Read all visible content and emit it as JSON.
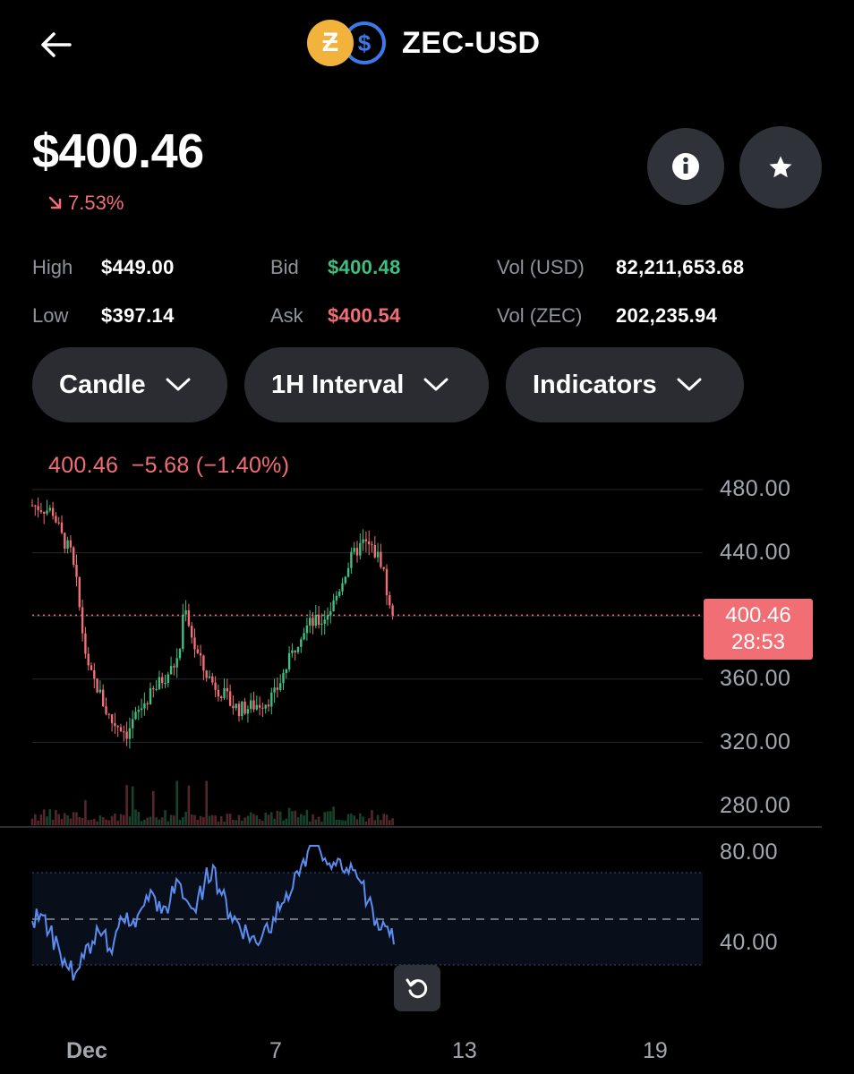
{
  "header": {
    "back_icon": "arrow-left-icon",
    "pair": "ZEC-USD",
    "base_symbol": "Ƶ",
    "quote_symbol": "$"
  },
  "price": {
    "current": "$400.46",
    "change_pct": "7.53%",
    "change_direction": "down"
  },
  "actions": {
    "info_icon": "info-icon",
    "favorite_icon": "star-icon"
  },
  "stats": {
    "high_label": "High",
    "high_value": "$449.00",
    "low_label": "Low",
    "low_value": "$397.14",
    "bid_label": "Bid",
    "bid_value": "$400.48",
    "ask_label": "Ask",
    "ask_value": "$400.54",
    "vol_usd_label": "Vol (USD)",
    "vol_usd_value": "82,211,653.68",
    "vol_zec_label": "Vol (ZEC)",
    "vol_zec_value": "202,235.94"
  },
  "controls": {
    "chart_type": "Candle",
    "interval": "1H Interval",
    "indicators": "Indicators"
  },
  "chart_data": [
    {
      "type": "candlestick",
      "ohlc_header": {
        "last": "400.46",
        "change": "−5.68",
        "change_pct": "(−1.40%)"
      },
      "current_price_tag": {
        "price": "400.46",
        "countdown": "28:53"
      },
      "y_ticks": [
        "480.00",
        "440.00",
        "360.00",
        "320.00",
        "280.00"
      ],
      "ylim": [
        280,
        480
      ],
      "x_ticks": [
        "Dec",
        "7",
        "13",
        "19"
      ],
      "close_path": [
        [
          0,
          470
        ],
        [
          4,
          468
        ],
        [
          7,
          466
        ],
        [
          10,
          450
        ],
        [
          13,
          440
        ],
        [
          15,
          420
        ],
        [
          17,
          390
        ],
        [
          19,
          365
        ],
        [
          22,
          355
        ],
        [
          25,
          340
        ],
        [
          27,
          333
        ],
        [
          30,
          330
        ],
        [
          32,
          326
        ],
        [
          35,
          336
        ],
        [
          38,
          345
        ],
        [
          41,
          352
        ],
        [
          44,
          360
        ],
        [
          47,
          366
        ],
        [
          49,
          372
        ],
        [
          50,
          380
        ],
        [
          51,
          400
        ],
        [
          52,
          407
        ],
        [
          53,
          396
        ],
        [
          55,
          380
        ],
        [
          58,
          366
        ],
        [
          61,
          358
        ],
        [
          64,
          352
        ],
        [
          67,
          345
        ],
        [
          70,
          341
        ],
        [
          73,
          342
        ],
        [
          76,
          344
        ],
        [
          79,
          346
        ],
        [
          82,
          350
        ],
        [
          85,
          363
        ],
        [
          88,
          376
        ],
        [
          91,
          390
        ],
        [
          94,
          395
        ],
        [
          96,
          396
        ],
        [
          98,
          397
        ],
        [
          100,
          402
        ],
        [
          102,
          408
        ],
        [
          104,
          418
        ],
        [
          106,
          428
        ],
        [
          108,
          436
        ],
        [
          110,
          442
        ],
        [
          112,
          446
        ],
        [
          114,
          444
        ],
        [
          116,
          440
        ],
        [
          118,
          435
        ],
        [
          119,
          428
        ],
        [
          120,
          415
        ],
        [
          121,
          404
        ],
        [
          122,
          400.46
        ]
      ],
      "volume_note": "volume bars along bottom of price pane"
    },
    {
      "type": "line",
      "name": "",
      "y_ticks": [
        "80.00",
        "40.00"
      ],
      "ylim": [
        30,
        90
      ],
      "midline": 50,
      "values": [
        48,
        52,
        44,
        38,
        30,
        26,
        34,
        41,
        44,
        38,
        46,
        52,
        47,
        55,
        61,
        52,
        58,
        66,
        57,
        54,
        66,
        72,
        60,
        52,
        48,
        44,
        40,
        46,
        50,
        56,
        62,
        68,
        80,
        86,
        77,
        74,
        70,
        73,
        66,
        58,
        50,
        46,
        40
      ]
    }
  ]
}
